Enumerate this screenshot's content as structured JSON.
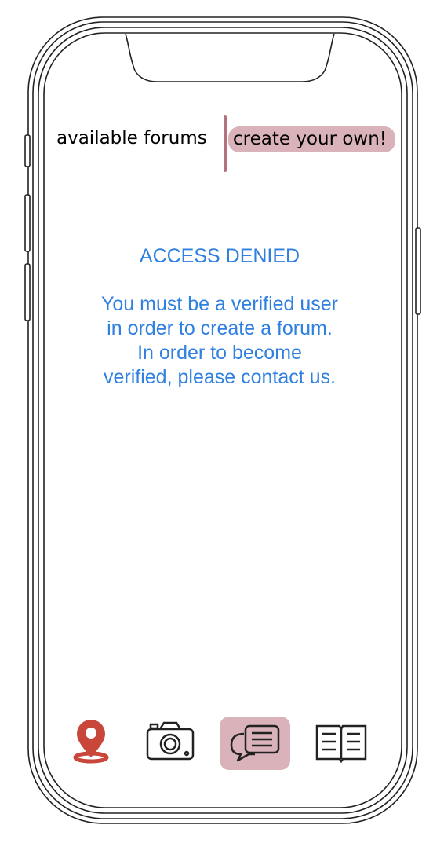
{
  "tabs": {
    "available_label": "available forums",
    "create_label": "create your own!"
  },
  "message": {
    "title": "ACCESS DENIED",
    "body": "You must be a verified user\nin order to create a forum.\nIn order to become\nverified, please contact us."
  },
  "nav": {
    "items": [
      {
        "icon": "map-pin-icon",
        "active": false
      },
      {
        "icon": "camera-icon",
        "active": false
      },
      {
        "icon": "chat-icon",
        "active": true
      },
      {
        "icon": "book-icon",
        "active": false
      }
    ]
  },
  "colors": {
    "message_text": "#2f80e0",
    "active_tab_bg": "#d9b3b9",
    "divider": "#b3727c",
    "map_pin": "#c9463a"
  }
}
